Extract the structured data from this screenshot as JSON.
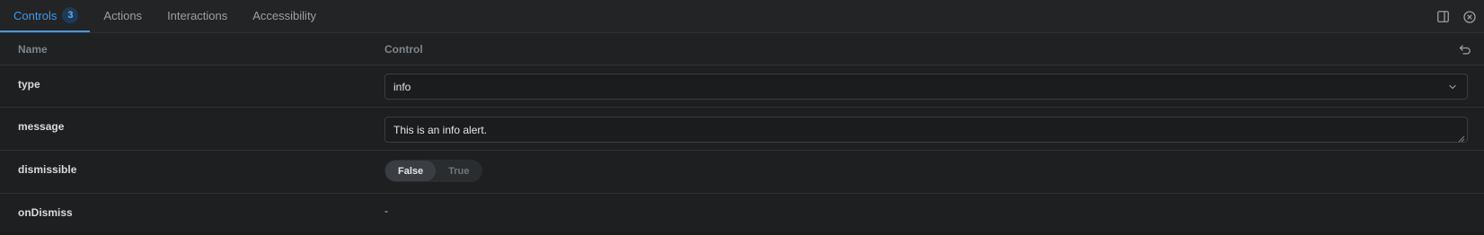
{
  "tabs": [
    {
      "label": "Controls",
      "badge": "3",
      "active": true
    },
    {
      "label": "Actions"
    },
    {
      "label": "Interactions"
    },
    {
      "label": "Accessibility"
    }
  ],
  "table": {
    "header": {
      "name": "Name",
      "control": "Control"
    },
    "rows": {
      "type": {
        "label": "type",
        "value": "info"
      },
      "message": {
        "label": "message",
        "value": "This is an info alert."
      },
      "dismissible": {
        "label": "dismissible",
        "options": [
          "False",
          "True"
        ],
        "selected": "False"
      },
      "onDismiss": {
        "label": "onDismiss",
        "value": "-"
      }
    }
  },
  "icons": {
    "panel_toggle": "sidebar-panel-icon",
    "close": "close-circle-icon",
    "reset": "undo-icon",
    "dropdown": "chevron-down-icon"
  },
  "colors": {
    "accent": "#3b9bf0",
    "background": "#1b1c1d"
  }
}
